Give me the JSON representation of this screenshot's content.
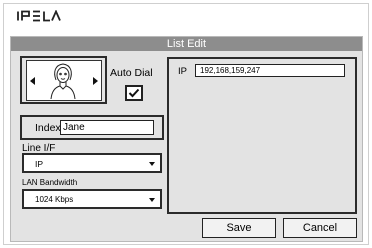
{
  "brand": {
    "logo": "IPELA"
  },
  "dialog": {
    "title": "List Edit"
  },
  "contact": {
    "image_icon": "person-portrait-icon"
  },
  "auto_dial": {
    "label": "Auto Dial",
    "checked": true
  },
  "ip": {
    "label": "IP",
    "value": "192,168,159,247"
  },
  "index": {
    "label": "Index",
    "value": "Jane"
  },
  "line_if": {
    "label": "Line I/F",
    "selected": "IP"
  },
  "lan_bandwidth": {
    "label": "LAN Bandwidth",
    "selected": "1024 Kbps"
  },
  "buttons": {
    "save": "Save",
    "cancel": "Cancel"
  }
}
